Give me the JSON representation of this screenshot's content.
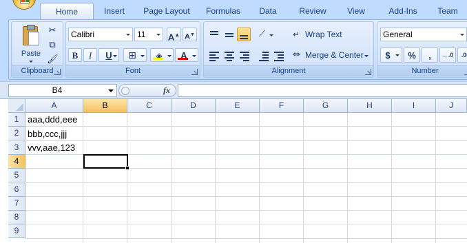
{
  "tabs": [
    {
      "label": "Home",
      "active": true
    },
    {
      "label": "Insert",
      "active": false
    },
    {
      "label": "Page Layout",
      "active": false
    },
    {
      "label": "Formulas",
      "active": false
    },
    {
      "label": "Data",
      "active": false
    },
    {
      "label": "Review",
      "active": false
    },
    {
      "label": "View",
      "active": false
    },
    {
      "label": "Add-Ins",
      "active": false
    },
    {
      "label": "Team",
      "active": false
    }
  ],
  "clipboard": {
    "title": "Clipboard",
    "paste_label": "Paste"
  },
  "font": {
    "title": "Font",
    "family": "Calibri",
    "size": "11",
    "grow": "A",
    "shrink": "A",
    "bold": "B",
    "italic": "I",
    "underline": "U"
  },
  "alignment": {
    "title": "Alignment",
    "wrap_text": "Wrap Text",
    "merge_center": "Merge & Center"
  },
  "number": {
    "title": "Number",
    "format": "General",
    "currency": "$",
    "percent": "%",
    "comma": ","
  },
  "formula_bar": {
    "name_box": "B4",
    "fx": "fx",
    "formula": ""
  },
  "columns": [
    "A",
    "B",
    "C",
    "D",
    "E",
    "F",
    "G",
    "H",
    "I",
    "J"
  ],
  "selected_column": "B",
  "rows": [
    "1",
    "2",
    "3",
    "4",
    "5",
    "6",
    "7",
    "8",
    "9"
  ],
  "selected_row": "4",
  "cells": {
    "A1": "aaa,ddd,eee",
    "A2": "bbb,ccc,jjj",
    "A3": "vvv,aae,123"
  },
  "colors": {
    "ribbon_bg": "#bfdbff",
    "group_text": "#15428b",
    "selected_header": "#f5c262",
    "gridline": "#d0d7e5",
    "font_color_underline": "#e00000",
    "fill_color_underline": "#ffff00"
  }
}
